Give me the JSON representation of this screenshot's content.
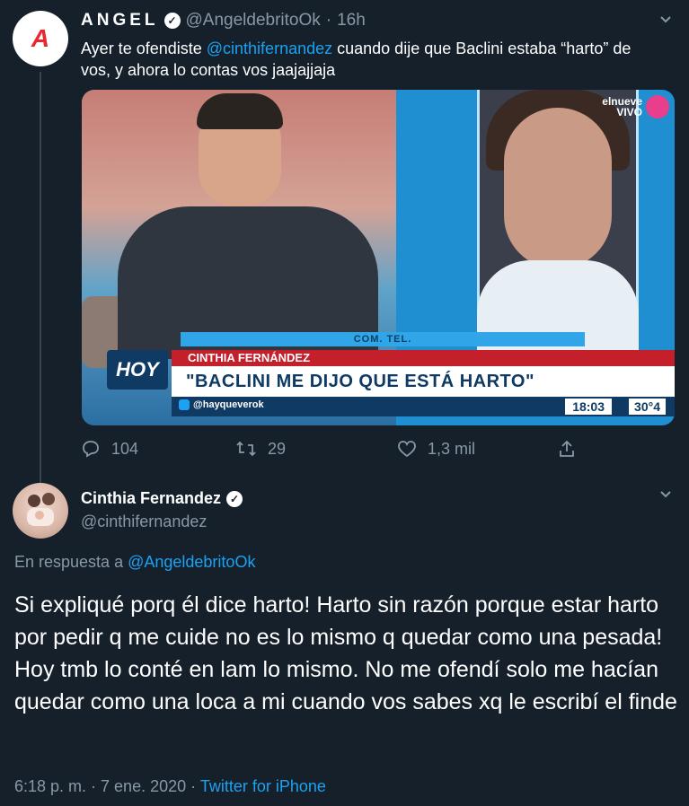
{
  "tweet1": {
    "avatar_letter": "A",
    "display_name": "ANGEL",
    "handle": "@AngeldebritoOk",
    "separator": " · ",
    "time": "16h",
    "text_before": "Ayer te ofendiste ",
    "mention": "@cinthifernandez",
    "text_after": " cuando dije que Baclini estaba “harto” de vos, y ahora lo contas vos jaajajjaja",
    "media": {
      "com_tel": "COM. TEL.",
      "show_logo": "HOY",
      "lower_third_name": "CINTHIA FERNÁNDEZ",
      "lower_third_quote": "\"BACLINI ME DIJO QUE ESTÁ HARTO\"",
      "twitter_handle": "@hayqueverok",
      "clock": "18:03",
      "temperature": "30°4",
      "channel": "elnueve",
      "channel_status": "VIVO"
    },
    "stats": {
      "replies": "104",
      "retweets": "29",
      "likes": "1,3 mil"
    }
  },
  "tweet2": {
    "display_name": "Cinthia Fernandez",
    "handle": "@cinthifernandez",
    "reply_prefix": "En respuesta a ",
    "reply_handle": "@AngeldebritoOk",
    "text": "Si expliqué porq él dice harto! Harto sin razón porque estar harto por pedir q me cuide no es lo mismo q quedar como una pesada! Hoy tmb lo conté en lam lo mismo. No me ofendí solo me hacían quedar como una loca a mi cuando vos sabes xq le escribí el finde",
    "timestamp": "6:18 p. m. · 7 ene. 2020",
    "separator": " · ",
    "source": "Twitter for iPhone"
  },
  "colors": {
    "background": "#15202b",
    "muted": "#8899a6",
    "link": "#1da1f2",
    "text": "#ffffff"
  }
}
